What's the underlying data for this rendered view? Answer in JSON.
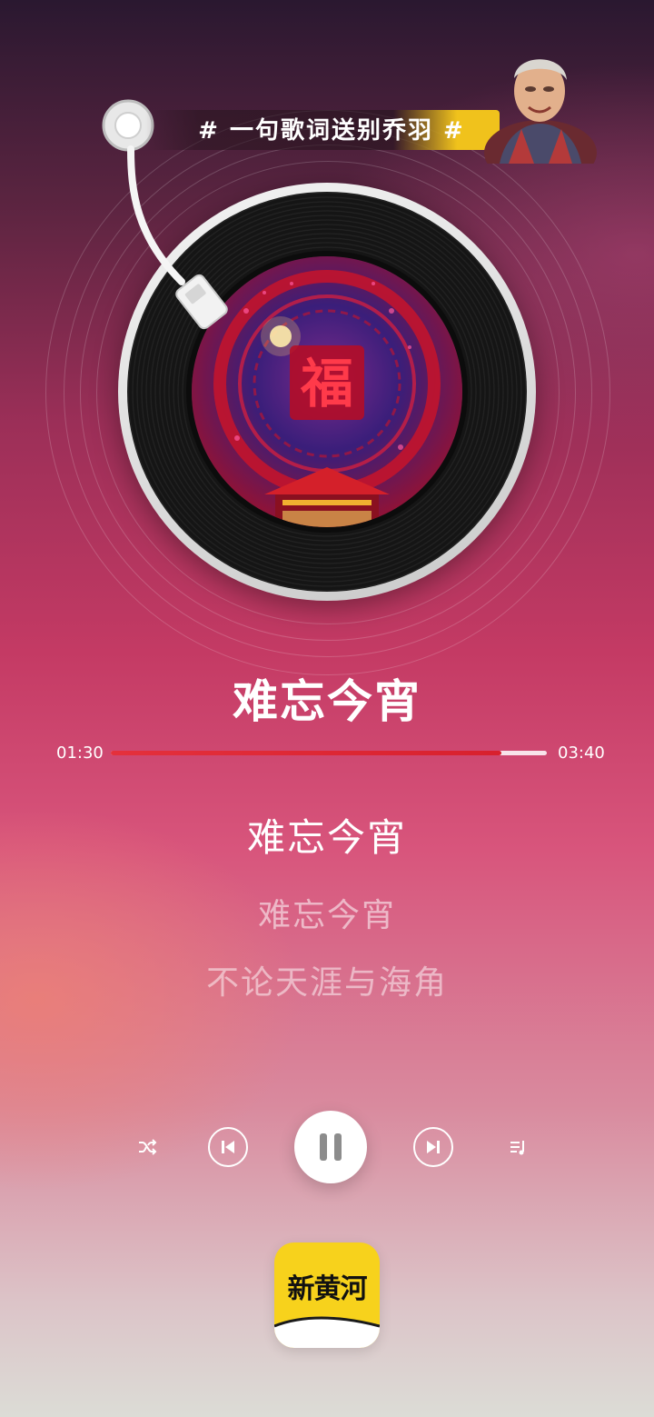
{
  "banner": {
    "text": "# 一句歌词送别乔羽 #"
  },
  "player": {
    "song_title": "难忘今宵",
    "time_current": "01:30",
    "time_total": "03:40",
    "progress": 0.896,
    "album_art_text": "福"
  },
  "lyrics": {
    "current": "难忘今宵",
    "next": [
      "难忘今宵",
      "不论天涯与海角"
    ]
  },
  "controls": {
    "shuffle_icon": "shuffle-icon",
    "prev_icon": "skip-previous-icon",
    "play_state": "playing",
    "next_icon": "skip-next-icon",
    "playlist_icon": "playlist-icon"
  },
  "app": {
    "logo_text": "新黄河"
  },
  "colors": {
    "accent": "#e4303c",
    "logo_bg": "#f7d21c"
  }
}
